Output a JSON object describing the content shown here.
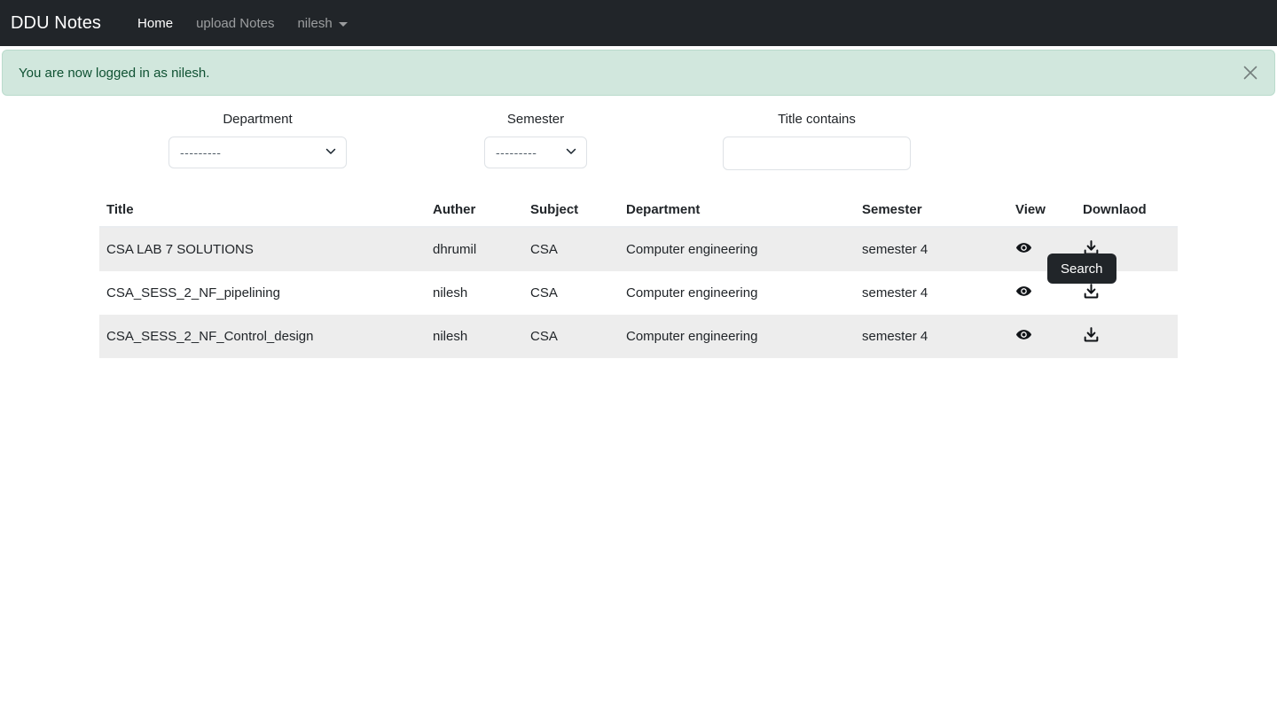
{
  "navbar": {
    "brand": "DDU Notes",
    "links": [
      {
        "label": "Home",
        "active": true
      },
      {
        "label": "upload Notes",
        "active": false
      }
    ],
    "user_menu": {
      "label": "nilesh",
      "icon": "caret-down-icon"
    }
  },
  "alert": {
    "message": "You are now logged in as nilesh.",
    "close_icon": "close-icon",
    "bg_color": "#d1e7dd",
    "text_color": "#0f5132",
    "border_color": "#badbcc"
  },
  "filters": {
    "department": {
      "label": "Department",
      "value": "---------",
      "icon": "chevron-down-icon"
    },
    "semester": {
      "label": "Semester",
      "value": "---------",
      "icon": "chevron-down-icon"
    },
    "title_contains": {
      "label": "Title contains",
      "value": "",
      "placeholder": ""
    },
    "search_button": {
      "label": "Search",
      "bg_color": "#212529",
      "text_color": "#ffffff"
    }
  },
  "table": {
    "headers": [
      "Title",
      "Auther",
      "Subject",
      "Department",
      "Semester",
      "View",
      "Downlaod"
    ],
    "rows": [
      {
        "title": "CSA LAB 7 SOLUTIONS",
        "auther": "dhrumil",
        "subject": "CSA",
        "department": "Computer engineering",
        "semester": "semester 4",
        "view_icon": "eye-icon",
        "download_icon": "download-icon"
      },
      {
        "title": "CSA_SESS_2_NF_pipelining",
        "auther": "nilesh",
        "subject": "CSA",
        "department": "Computer engineering",
        "semester": "semester 4",
        "view_icon": "eye-icon",
        "download_icon": "download-icon"
      },
      {
        "title": "CSA_SESS_2_NF_Control_design",
        "auther": "nilesh",
        "subject": "CSA",
        "department": "Computer engineering",
        "semester": "semester 4",
        "view_icon": "eye-icon",
        "download_icon": "download-icon"
      }
    ]
  }
}
